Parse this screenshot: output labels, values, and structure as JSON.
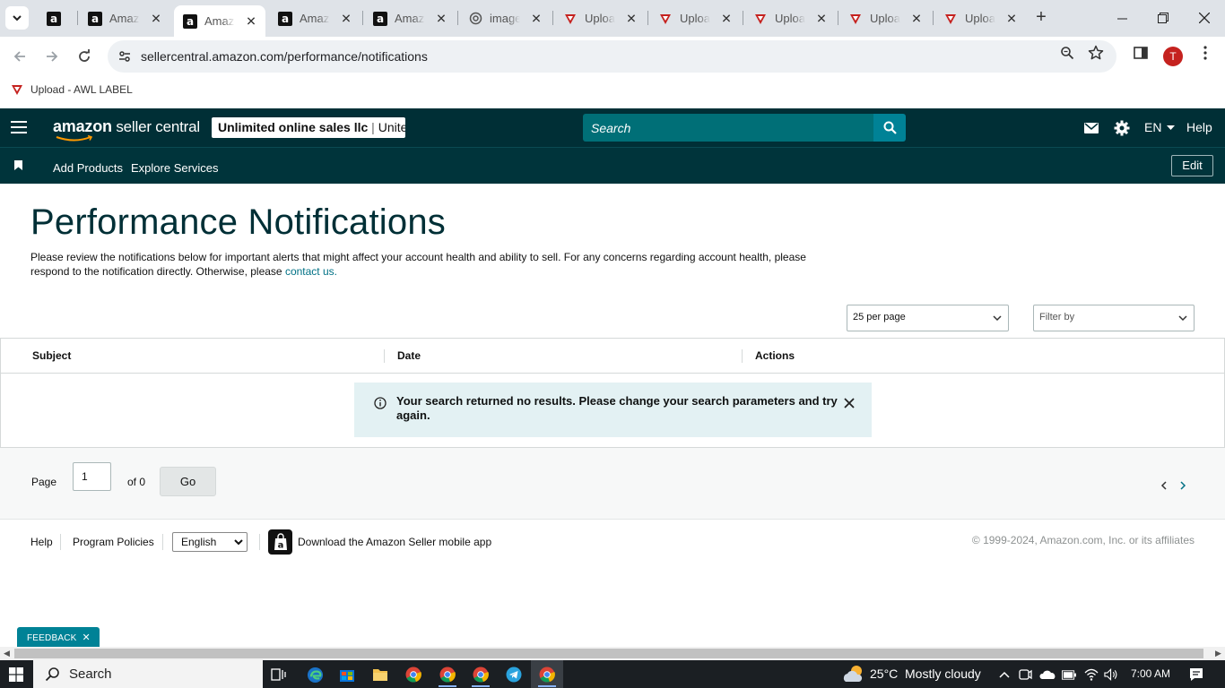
{
  "browser": {
    "tabs": [
      {
        "title": "",
        "icon": "amazon-favicon",
        "active": false
      },
      {
        "title": "Amazon",
        "icon": "amazon-favicon",
        "active": false
      },
      {
        "title": "Amazon",
        "icon": "amazon-favicon",
        "active": true
      },
      {
        "title": "Amazon",
        "icon": "amazon-favicon",
        "active": false
      },
      {
        "title": "Amazon",
        "icon": "amazon-favicon",
        "active": false
      },
      {
        "title": "image",
        "icon": "openai-favicon",
        "active": false
      },
      {
        "title": "Upload",
        "icon": "awl-favicon",
        "active": false
      },
      {
        "title": "Upload",
        "icon": "awl-favicon",
        "active": false
      },
      {
        "title": "Upload",
        "icon": "awl-favicon",
        "active": false
      },
      {
        "title": "Upload",
        "icon": "awl-favicon",
        "active": false
      },
      {
        "title": "Upload",
        "icon": "awl-favicon",
        "active": false
      }
    ],
    "url": "sellercentral.amazon.com/performance/notifications",
    "profile_initial": "T",
    "bookmark": {
      "label": "Upload - AWL LABEL",
      "icon": "awl-favicon"
    },
    "accent": "#c5221f"
  },
  "header": {
    "logo_brand": "amazon",
    "logo_product": "seller central",
    "account_name": "Unlimited online sales llc",
    "account_region": "Unite...",
    "search_placeholder": "Search",
    "language": "EN",
    "help": "Help",
    "colors": {
      "bar": "#002f36",
      "search": "#006f77",
      "search_button": "#008296"
    }
  },
  "nav": {
    "links": [
      "Add Products",
      "Explore Services"
    ],
    "edit": "Edit"
  },
  "main": {
    "title": "Performance Notifications",
    "description": "Please review the notifications below for important alerts that might affect your account health and ability to sell. For any concerns regarding account health, please respond to the notification directly. Otherwise, please ",
    "contact_link": "contact us.",
    "per_page": "25 per page",
    "filter_placeholder": "Filter by",
    "columns": [
      "Subject",
      "Date",
      "Actions"
    ],
    "alert": "Your search returned no results. Please change your search parameters and try again."
  },
  "pager": {
    "page_label": "Page",
    "page_value": "1",
    "of_label": "of 0",
    "go": "Go"
  },
  "footer": {
    "help": "Help",
    "policies": "Program Policies",
    "language": "English",
    "app_text": "Download the Amazon Seller mobile app",
    "copyright": "© 1999-2024, Amazon.com, Inc. or its affiliates"
  },
  "feedback": "FEEDBACK",
  "taskbar": {
    "search": "Search",
    "temperature": "25°C",
    "weather": "Mostly cloudy",
    "time": "7:00 AM"
  }
}
